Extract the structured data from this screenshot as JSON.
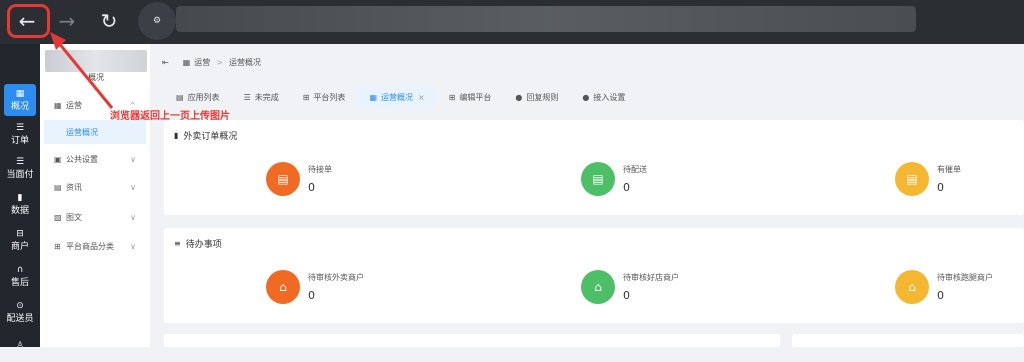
{
  "browser": {
    "back_icon": "←",
    "forward_icon": "→",
    "reload_icon": "↻",
    "tune_icon": "⚙"
  },
  "nav_rail": [
    {
      "icon": "▦",
      "label": "概况",
      "active": true
    },
    {
      "icon": "☰",
      "label": "订单"
    },
    {
      "icon": "☰",
      "label": "当面付"
    },
    {
      "icon": "▮",
      "label": "数据"
    },
    {
      "icon": "⊟",
      "label": "商户"
    },
    {
      "icon": "∩",
      "label": "售后"
    },
    {
      "icon": "⊙",
      "label": "配送员"
    },
    {
      "icon": "♙",
      "label": ""
    }
  ],
  "side_menu": {
    "label_top": "概况",
    "items": [
      {
        "icon": "▦",
        "label": "运营",
        "arrow": "^"
      },
      {
        "label": "运营概况",
        "sub": true
      },
      {
        "icon": "▣",
        "label": "公共设置",
        "arrow": "∨"
      },
      {
        "icon": "▤",
        "label": "资讯",
        "arrow": "∨"
      },
      {
        "icon": "▧",
        "label": "图文",
        "arrow": "∨"
      },
      {
        "icon": "⊞",
        "label": "平台商品分类",
        "arrow": "∨"
      }
    ]
  },
  "annotation": {
    "text": "浏览器返回上一页上传图片"
  },
  "breadcrumb": {
    "collapse_icon": "⇤",
    "home_icon": "▦",
    "root": "运营",
    "sep": ">",
    "current": "运营概况"
  },
  "tabs": [
    {
      "icon": "▤",
      "label": "应用列表"
    },
    {
      "icon": "☰",
      "label": "未完成"
    },
    {
      "icon": "⊞",
      "label": "平台列表"
    },
    {
      "icon": "▦",
      "label": "运营概况",
      "active": true,
      "close": "×"
    },
    {
      "icon": "⊞",
      "label": "编辑平台"
    },
    {
      "icon": "●",
      "label": "回复规则"
    },
    {
      "icon": "●",
      "label": "接入设置"
    }
  ],
  "cards": {
    "orders": {
      "icon": "▮",
      "title": "外卖订单概况",
      "stats": [
        {
          "label": "待接单",
          "value": "0",
          "color": "#f06a24",
          "icon": "▤"
        },
        {
          "label": "待配送",
          "value": "0",
          "color": "#4cbf67",
          "icon": "▤"
        },
        {
          "label": "有催单",
          "value": "0",
          "color": "#f5b731",
          "icon": "▤"
        }
      ]
    },
    "todo": {
      "icon": "≡",
      "title": "待办事项",
      "stats": [
        {
          "label": "待审核外卖商户",
          "value": "0",
          "color": "#f06a24",
          "icon": "⌂"
        },
        {
          "label": "待审核好店商户",
          "value": "0",
          "color": "#4cbf67",
          "icon": "⌂"
        },
        {
          "label": "待审核跑腿商户",
          "value": "0",
          "color": "#f5b731",
          "icon": "⌂"
        }
      ]
    }
  }
}
